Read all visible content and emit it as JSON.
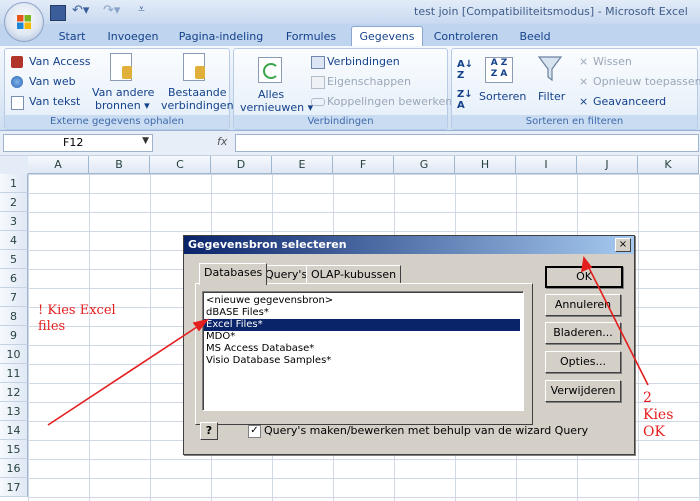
{
  "window": {
    "title": "test join  [Compatibiliteitsmodus] - Microsoft Excel"
  },
  "ribbon": {
    "tabs": [
      {
        "label": "Start"
      },
      {
        "label": "Invoegen"
      },
      {
        "label": "Pagina-indeling"
      },
      {
        "label": "Formules"
      },
      {
        "label": "Gegevens",
        "active": true
      },
      {
        "label": "Controleren"
      },
      {
        "label": "Beeld"
      }
    ],
    "groups": {
      "external": {
        "label": "Externe gegevens ophalen",
        "van_access": "Van Access",
        "van_web": "Van web",
        "van_tekst": "Van tekst",
        "van_andere_1": "Van andere",
        "van_andere_2": "bronnen",
        "bestaande_1": "Bestaande",
        "bestaande_2": "verbindingen"
      },
      "connections": {
        "label": "Verbindingen",
        "alles_1": "Alles",
        "alles_2": "vernieuwen",
        "verbindingen": "Verbindingen",
        "eigenschappen": "Eigenschappen",
        "koppelingen": "Koppelingen bewerken"
      },
      "sort": {
        "label": "Sorteren en filteren",
        "sorteren": "Sorteren",
        "filter": "Filter",
        "wissen": "Wissen",
        "opnieuw": "Opnieuw toepassen",
        "geavanceerd": "Geavanceerd",
        "az": "A Z",
        "za": "Z A"
      }
    }
  },
  "formula_bar": {
    "name_box": "F12",
    "fx": "fx",
    "formula": ""
  },
  "grid": {
    "columns": [
      "A",
      "B",
      "C",
      "D",
      "E",
      "F",
      "G",
      "H",
      "I",
      "J",
      "K"
    ],
    "rows": [
      "1",
      "2",
      "3",
      "4",
      "5",
      "6",
      "7",
      "8",
      "9",
      "10",
      "11",
      "12",
      "13",
      "14",
      "15",
      "16",
      "17"
    ]
  },
  "dialog": {
    "title": "Gegevensbron selecteren",
    "close": "×",
    "tabs": [
      "Databases",
      "Query's",
      "OLAP-kubussen"
    ],
    "list_items": [
      "<nieuwe gegevensbron>",
      "dBASE Files*",
      "Excel Files*",
      "MDO*",
      "MS Access Database*",
      "Visio Database Samples*"
    ],
    "selected_index": 2,
    "buttons": {
      "ok": "OK",
      "cancel": "Annuleren",
      "browse": "Bladeren...",
      "options": "Opties...",
      "delete": "Verwijderen"
    },
    "help": "?",
    "wizard_checkbox": {
      "label": "Query's maken/bewerken met behulp van de wizard Query",
      "checked": true,
      "mark": "✓"
    }
  },
  "annotations": {
    "left": {
      "line1": "! Kies Excel",
      "line2": "files"
    },
    "right": {
      "line1": "2",
      "line2": "Kies",
      "line3": "OK"
    }
  },
  "colors": {
    "annotation_red": "#e41e1e",
    "selection_blue": "#0a246a",
    "ribbon_text": "#15428b"
  }
}
